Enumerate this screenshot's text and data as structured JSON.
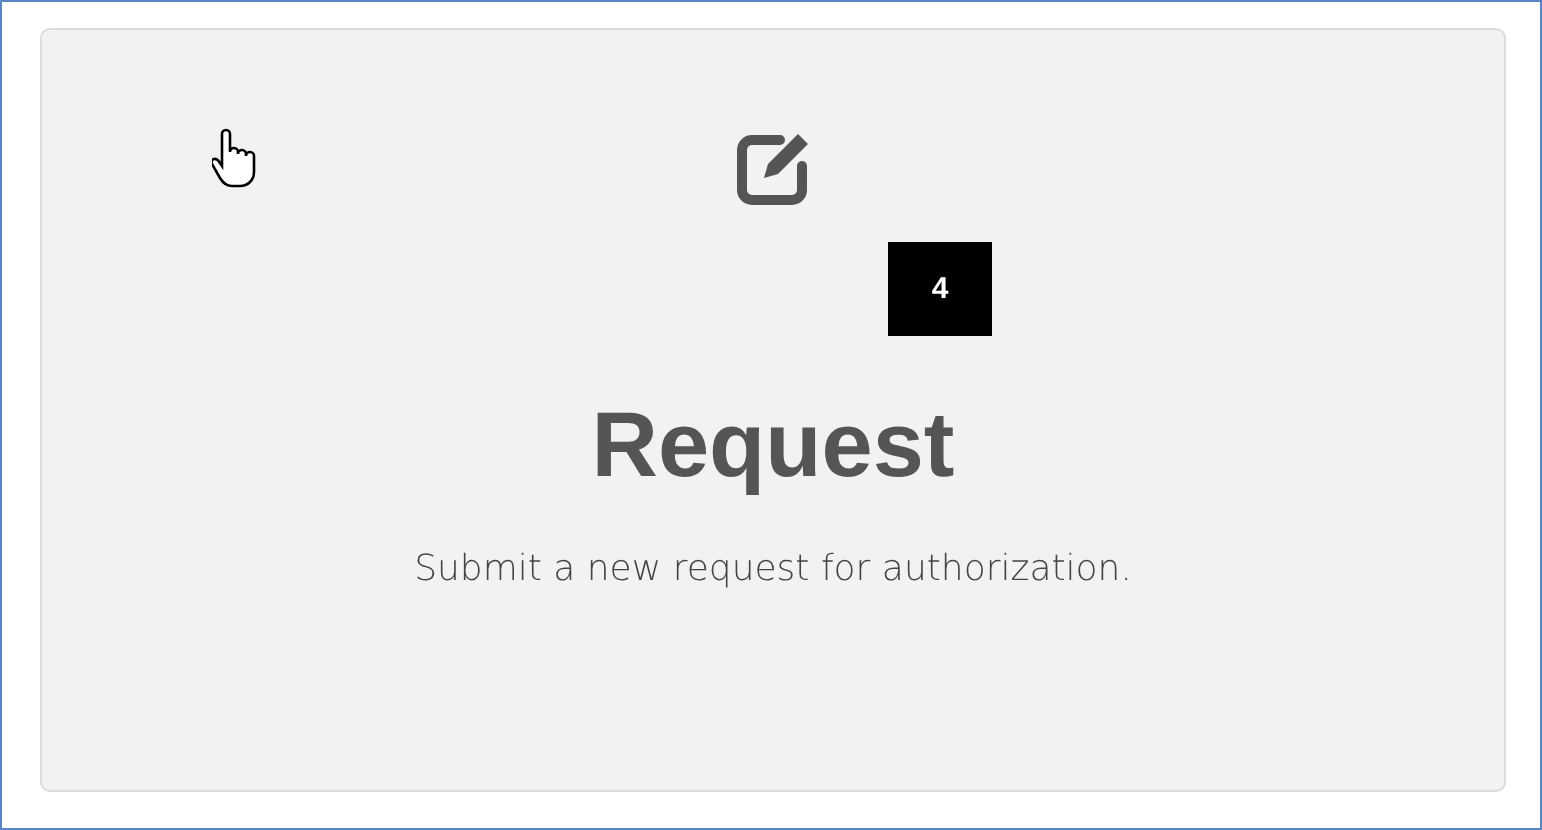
{
  "card": {
    "title": "Request",
    "description": "Submit a new request for authorization.",
    "badge": "4"
  }
}
